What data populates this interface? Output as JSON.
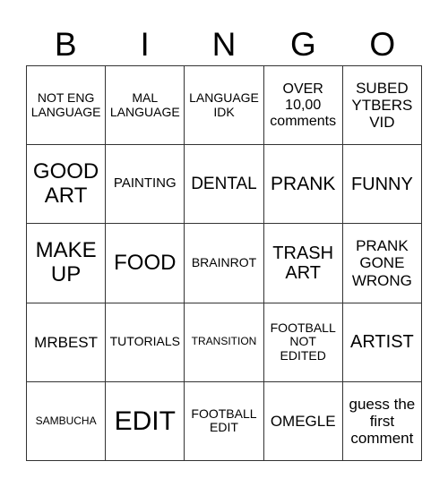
{
  "header": {
    "letters": [
      "B",
      "I",
      "N",
      "G",
      "O"
    ]
  },
  "cells": [
    [
      "NOT ENG LANGUAGE",
      "MAL LANGUAGE",
      "LANGUAGE IDK",
      "OVER 10,00 comments",
      "SUBED YTBERS VID"
    ],
    [
      "GOOD ART",
      "PAINTING",
      "DENTAL",
      "PRANK",
      "FUNNY"
    ],
    [
      "MAKE UP",
      "FOOD",
      "BRAINROT",
      "TRASH ART",
      "PRANK GONE WRONG"
    ],
    [
      "MRBEST",
      "TUTORIALS",
      "TRANSITION",
      "FOOTBALL NOT EDITED",
      "ARTIST"
    ],
    [
      "SAMBUCHA",
      "EDIT",
      "FOOTBALL EDIT",
      "OMEGLE",
      "guess the first comment"
    ]
  ]
}
